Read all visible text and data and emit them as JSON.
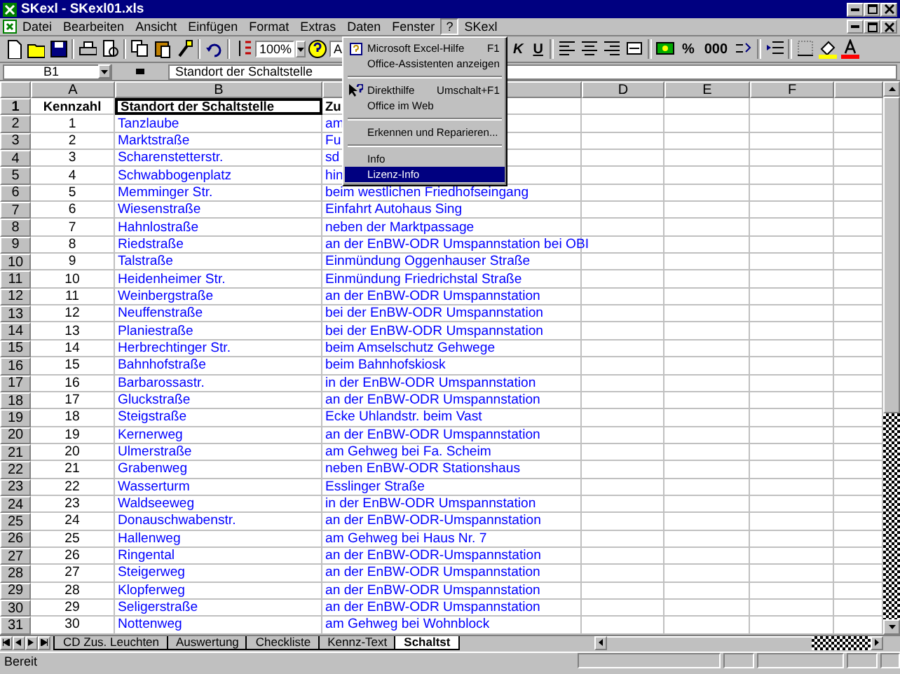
{
  "window": {
    "title": "SKexl - SKexl01.xls"
  },
  "menu_bar": {
    "items": [
      {
        "label": "Datei",
        "selected": false
      },
      {
        "label": "Bearbeiten",
        "selected": false
      },
      {
        "label": "Ansicht",
        "selected": false
      },
      {
        "label": "Einfügen",
        "selected": false
      },
      {
        "label": "Format",
        "selected": false
      },
      {
        "label": "Extras",
        "selected": false
      },
      {
        "label": "Daten",
        "selected": false
      },
      {
        "label": "Fenster",
        "selected": false
      },
      {
        "label": "?",
        "selected": true
      },
      {
        "label": "SKexl",
        "selected": false
      }
    ]
  },
  "toolbar": {
    "zoom": "100%",
    "font_box": "A",
    "text_buttons": [
      "K",
      "U"
    ],
    "number_buttons": [
      "%",
      "000"
    ]
  },
  "formula_bar": {
    "cell": "B1",
    "content": "Standort der Schaltstelle"
  },
  "help_menu": {
    "items": [
      {
        "kind": "item",
        "label": "Microsoft Excel-Hilfe",
        "shortcut": "F1",
        "icon": true,
        "selected": false
      },
      {
        "kind": "item",
        "label": "Office-Assistenten anzeigen",
        "selected": false
      },
      {
        "kind": "separator"
      },
      {
        "kind": "item",
        "label": "Direkthilfe",
        "shortcut": "Umschalt+F1",
        "icon": true,
        "selected": false
      },
      {
        "kind": "item",
        "label": "Office im Web",
        "selected": false
      },
      {
        "kind": "separator"
      },
      {
        "kind": "item",
        "label": "Erkennen und Reparieren...",
        "selected": false
      },
      {
        "kind": "separator"
      },
      {
        "kind": "item",
        "label": "Info",
        "selected": false
      },
      {
        "kind": "item",
        "label": "Lizenz-Info",
        "selected": true
      }
    ]
  },
  "columns": [
    "A",
    "B",
    "D",
    "E",
    "F"
  ],
  "header_row": {
    "number": "1",
    "cells": [
      {
        "text": "Kennzahl",
        "selected": false
      },
      {
        "text": "Standort der Schaltstelle",
        "selected": true
      },
      {
        "text": "Zu",
        "selected": false
      }
    ]
  },
  "rows": [
    {
      "number": "2",
      "cells": [
        "1",
        "Tanzlaube",
        "am"
      ]
    },
    {
      "number": "3",
      "cells": [
        "2",
        "Marktstraße",
        "Fu"
      ]
    },
    {
      "number": "4",
      "cells": [
        "3",
        "Scharenstetterstr.",
        "sd"
      ]
    },
    {
      "number": "5",
      "cells": [
        "4",
        "Schwabbogenplatz",
        "hin"
      ]
    },
    {
      "number": "6",
      "cells": [
        "5",
        "Memminger Str.",
        "beim westlichen Friedhofseingang"
      ]
    },
    {
      "number": "7",
      "cells": [
        "6",
        "Wiesenstraße",
        "Einfahrt Autohaus Sing"
      ]
    },
    {
      "number": "8",
      "cells": [
        "7",
        "Hahnlostraße",
        "neben der Marktpassage"
      ]
    },
    {
      "number": "9",
      "cells": [
        "8",
        "Riedstraße",
        "an der EnBW-ODR Umspannstation bei OBI"
      ]
    },
    {
      "number": "10",
      "cells": [
        "9",
        "Talstraße",
        "Einmündung Oggenhauser Straße"
      ]
    },
    {
      "number": "11",
      "cells": [
        "10",
        "Heidenheimer Str.",
        "Einmündung Friedrichstal Straße"
      ]
    },
    {
      "number": "12",
      "cells": [
        "11",
        "Weinbergstraße",
        "an der EnBW-ODR Umspannstation"
      ]
    },
    {
      "number": "13",
      "cells": [
        "12",
        "Neuffenstraße",
        "bei der EnBW-ODR Umspannstation"
      ]
    },
    {
      "number": "14",
      "cells": [
        "13",
        "Planiestraße",
        "bei der EnBW-ODR Umspannstation"
      ]
    },
    {
      "number": "15",
      "cells": [
        "14",
        "Herbrechtinger Str.",
        "beim Amselschutz Gehwege"
      ]
    },
    {
      "number": "16",
      "cells": [
        "15",
        "Bahnhofstraße",
        "beim Bahnhofskiosk"
      ]
    },
    {
      "number": "17",
      "cells": [
        "16",
        "Barbarossastr.",
        "in der EnBW-ODR Umspannstation"
      ]
    },
    {
      "number": "18",
      "cells": [
        "17",
        "Gluckstraße",
        "an der EnBW-ODR Umspannstation"
      ]
    },
    {
      "number": "19",
      "cells": [
        "18",
        "Steigstraße",
        "Ecke Uhlandstr. beim Vast"
      ]
    },
    {
      "number": "20",
      "cells": [
        "19",
        "Kernerweg",
        "an der EnBW-ODR Umspannstation"
      ]
    },
    {
      "number": "21",
      "cells": [
        "20",
        "Ulmerstraße",
        "am Gehweg bei Fa. Scheim"
      ]
    },
    {
      "number": "22",
      "cells": [
        "21",
        "Grabenweg",
        "neben EnBW-ODR Stationshaus"
      ]
    },
    {
      "number": "23",
      "cells": [
        "22",
        "Wasserturm",
        "Esslinger Straße"
      ]
    },
    {
      "number": "24",
      "cells": [
        "23",
        "Waldseeweg",
        "in der EnBW-ODR Umspannstation"
      ]
    },
    {
      "number": "25",
      "cells": [
        "24",
        "Donauschwabenstr.",
        "an der EnBW-ODR-Umspannstation"
      ]
    },
    {
      "number": "26",
      "cells": [
        "25",
        "Hallenweg",
        "am Gehweg bei Haus Nr. 7"
      ]
    },
    {
      "number": "27",
      "cells": [
        "26",
        "Ringental",
        "an der EnBW-ODR-Umspannstation"
      ]
    },
    {
      "number": "28",
      "cells": [
        "27",
        "Steigerweg",
        "an der EnBW-ODR Umspannstation"
      ]
    },
    {
      "number": "29",
      "cells": [
        "28",
        "Klopferweg",
        "an der EnBW-ODR Umspannstation"
      ]
    },
    {
      "number": "30",
      "cells": [
        "29",
        "Seligerstraße",
        "an der EnBW-ODR Umspannstation"
      ]
    },
    {
      "number": "31",
      "cells": [
        "30",
        "Nottenweg",
        "am Gehweg bei Wohnblock"
      ]
    }
  ],
  "sheet_tabs": [
    {
      "label": "CD Zus. Leuchten",
      "selected": false
    },
    {
      "label": "Auswertung",
      "selected": false
    },
    {
      "label": "Checkliste",
      "selected": false
    },
    {
      "label": "Kennz-Text",
      "selected": false
    },
    {
      "label": "Schaltst",
      "selected": true
    }
  ],
  "status_bar": {
    "text": "Bereit"
  }
}
